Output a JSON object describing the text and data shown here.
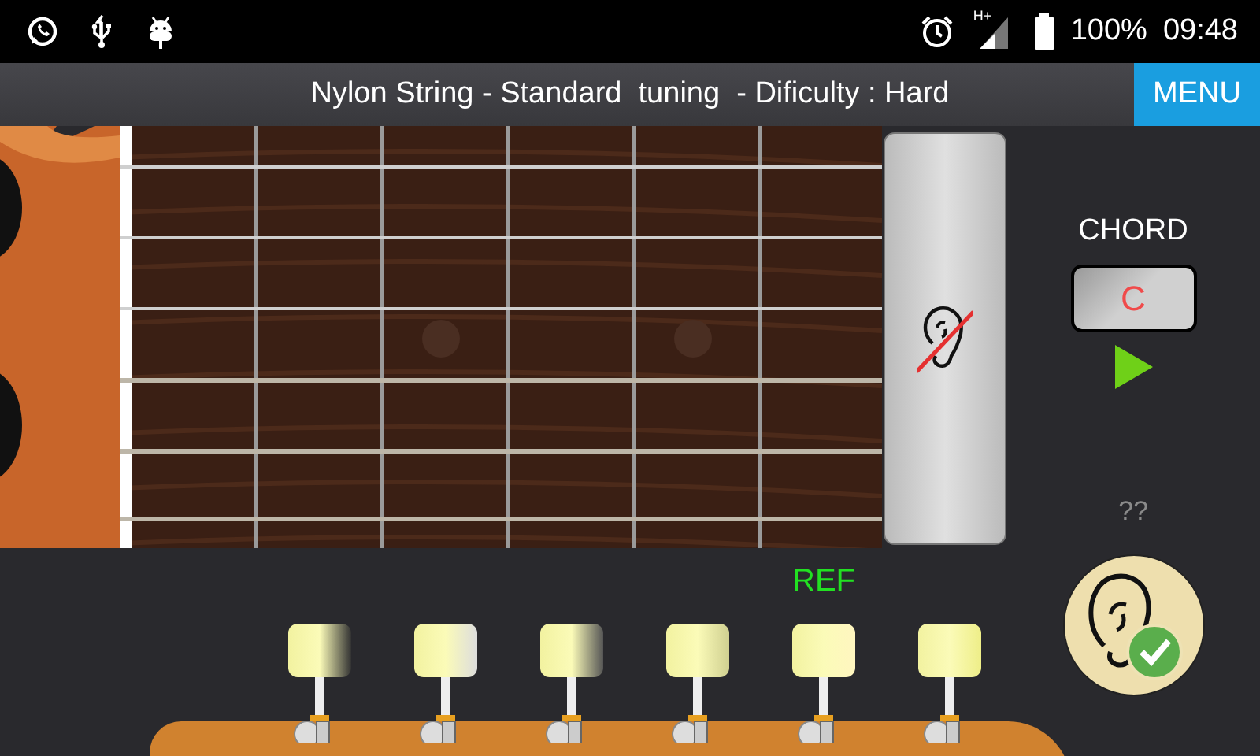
{
  "status_bar": {
    "network": "H+",
    "battery": "100%",
    "time": "09:48"
  },
  "title_bar": {
    "title": "Nylon String - Standard  tuning  - Dificulty : Hard",
    "menu": "MENU"
  },
  "chord": {
    "label": "CHORD",
    "value": "C"
  },
  "hint": "??",
  "reference_label": "REF",
  "pegs": [
    {
      "kind": "plain"
    },
    {
      "kind": "plain"
    },
    {
      "kind": "plain"
    },
    {
      "kind": "plain"
    },
    {
      "kind": "reference"
    },
    {
      "kind": "plain"
    }
  ]
}
